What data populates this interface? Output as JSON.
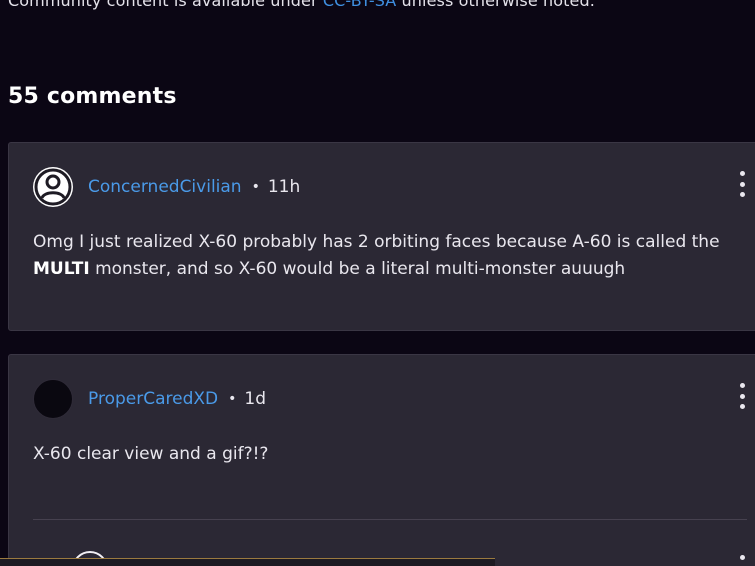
{
  "license": {
    "prefix": "Community content is available under ",
    "link": "CC-BY-SA",
    "suffix": " unless otherwise noted."
  },
  "comments": {
    "count_label": "55 comments",
    "items": [
      {
        "username": "ConcernedCivilian",
        "separator": "•",
        "time": "11h",
        "text_before": "Omg I just realized X-60 probably has 2 orbiting faces because A-60 is called the ",
        "text_bold": "MULTI",
        "text_after": " monster, and so X-60 would be a literal multi-monster auuugh"
      },
      {
        "username": "ProperCaredXD",
        "separator": "•",
        "time": "1d",
        "text": "X-60 clear view and a gif?!?"
      }
    ]
  },
  "icons": {
    "avatar_default": "user-circle-icon",
    "more_menu": "kebab-menu-icon"
  },
  "colors": {
    "background": "#0b0614",
    "card": "#2b2834",
    "link": "#4a9ae8"
  }
}
